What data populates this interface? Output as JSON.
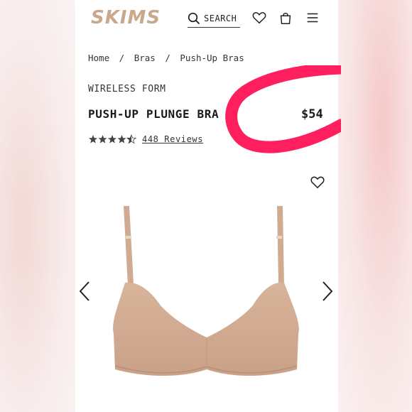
{
  "brand": {
    "logo_text": "SKIMS",
    "logo_color": "#c9a88c"
  },
  "header": {
    "search_label": "SEARCH",
    "icons": [
      "search-icon",
      "heart-icon",
      "bag-icon",
      "menu-icon"
    ]
  },
  "breadcrumb": {
    "items": [
      "Home",
      "Bras",
      "Push-Up Bras"
    ],
    "separator": "/"
  },
  "product": {
    "eyebrow": "WIRELESS FORM",
    "name": "PUSH-UP PLUNGE BRA",
    "price": "$54",
    "rating": 4.5,
    "rating_max": 5,
    "reviews_label": "448 Reviews"
  },
  "gallery": {
    "icons": [
      "heart-icon",
      "chevron-left-icon",
      "chevron-right-icon"
    ]
  },
  "colors": {
    "highlight": "#ff1f5e",
    "product": "#d4ad94",
    "text": "#1a1a1a"
  }
}
